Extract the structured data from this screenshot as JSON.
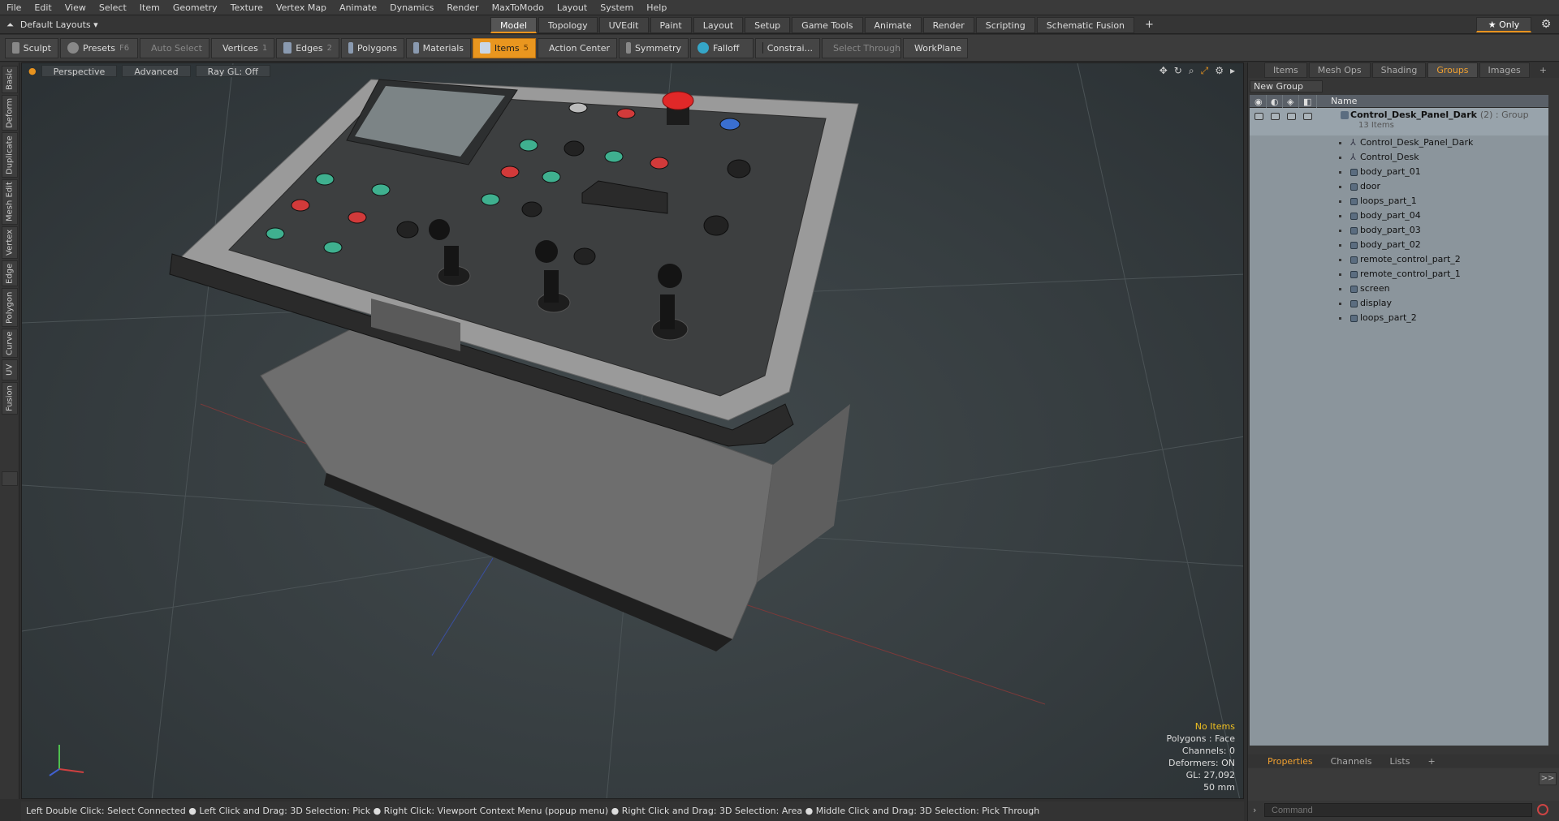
{
  "menu": [
    "File",
    "Edit",
    "View",
    "Select",
    "Item",
    "Geometry",
    "Texture",
    "Vertex Map",
    "Animate",
    "Dynamics",
    "Render",
    "MaxToModo",
    "Layout",
    "System",
    "Help"
  ],
  "layout_dropdown": {
    "label": "Default Layouts ▾"
  },
  "layout_tabs": [
    "Model",
    "Topology",
    "UVEdit",
    "Paint",
    "Layout",
    "Setup",
    "Game Tools",
    "Animate",
    "Render",
    "Scripting",
    "Schematic Fusion",
    "+"
  ],
  "active_layout_tab": "Model",
  "only_button": "★ Only",
  "toolbar": {
    "sculpt": "Sculpt",
    "presets": "Presets",
    "presets_key": "F6",
    "auto_select": "Auto Select",
    "vertices": "Vertices",
    "vertices_key": "1",
    "edges": "Edges",
    "edges_key": "2",
    "polygons": "Polygons",
    "materials": "Materials",
    "items": "Items",
    "items_key": "5",
    "action_center": "Action Center",
    "symmetry": "Symmetry",
    "falloff": "Falloff",
    "constrain": "Constrai...",
    "select_through": "Select Through",
    "workplane": "WorkPlane"
  },
  "left_tabs": [
    "Basic",
    "Deform",
    "Duplicate",
    "Mesh Edit",
    "Vertex",
    "Edge",
    "Polygon",
    "Curve",
    "UV",
    "Fusion"
  ],
  "viewport": {
    "view": "Perspective",
    "mode": "Advanced",
    "raygl": "Ray GL: Off"
  },
  "viewport_info": {
    "no_items": "No Items",
    "polygons": "Polygons : Face",
    "channels": "Channels: 0",
    "deformers": "Deformers: ON",
    "gl": "GL: 27,092",
    "lens": "50 mm"
  },
  "status_bar": "Left Double Click: Select Connected ● Left Click and Drag: 3D Selection: Pick ● Right Click: Viewport Context Menu (popup menu) ● Right Click and Drag: 3D Selection: Area ● Middle Click and Drag: 3D Selection: Pick Through",
  "right_panel": {
    "tabs": [
      "Items",
      "Mesh Ops",
      "Shading",
      "Groups",
      "Images",
      "+"
    ],
    "active_tab": "Groups",
    "new_group": "New Group",
    "column_name": "Name",
    "group": {
      "name": "Control_Desk_Panel_Dark",
      "suffix": "(2) : Group",
      "count": "13 Items"
    },
    "items": [
      "Control_Desk_Panel_Dark",
      "Control_Desk",
      "body_part_01",
      "door",
      "loops_part_1",
      "body_part_04",
      "body_part_03",
      "body_part_02",
      "remote_control_part_2",
      "remote_control_part_1",
      "screen",
      "display",
      "loops_part_2"
    ],
    "bottom_tabs": [
      "Properties",
      "Channels",
      "Lists",
      "+"
    ],
    "active_bottom_tab": "Properties",
    "expand": ">>",
    "command_placeholder": "Command"
  },
  "colors": {
    "accent": "#e9961f",
    "button_red": "#d23a3a",
    "button_green": "#3fb08f",
    "button_blue": "#3a6fd0",
    "estop": "#e02828"
  }
}
